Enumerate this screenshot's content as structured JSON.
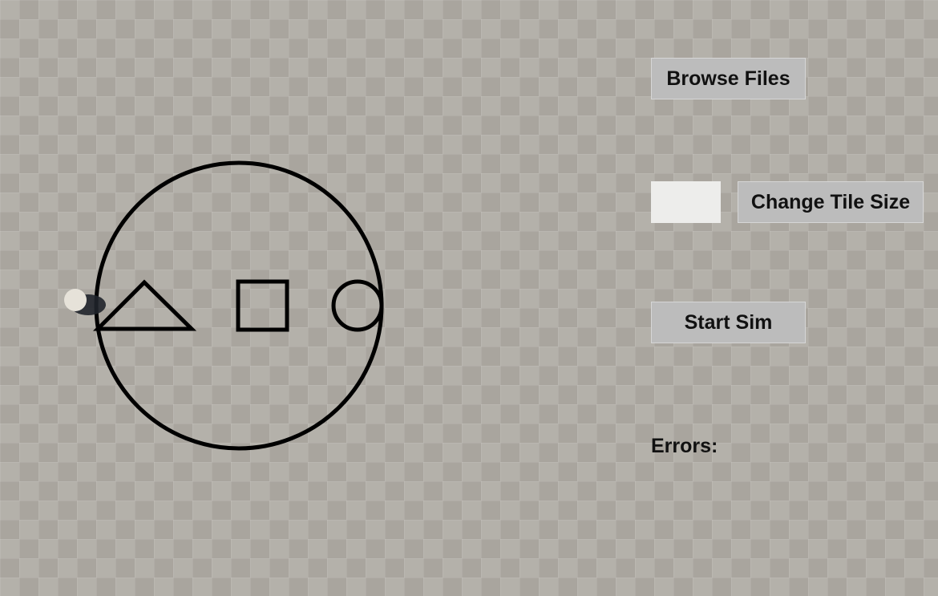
{
  "controls": {
    "browse_label": "Browse Files",
    "tile_size_value": "",
    "change_tile_label": "Change Tile Size",
    "start_label": "Start Sim",
    "errors_label": "Errors:"
  },
  "scene": {
    "shapes": [
      "big-circle",
      "triangle",
      "square",
      "small-circle"
    ],
    "robot": "robot-marker"
  },
  "colors": {
    "floor_light": "#b4b1aa",
    "floor_dark": "#a9a59e",
    "button_bg": "#bcbcbc",
    "outline": "#000000"
  }
}
